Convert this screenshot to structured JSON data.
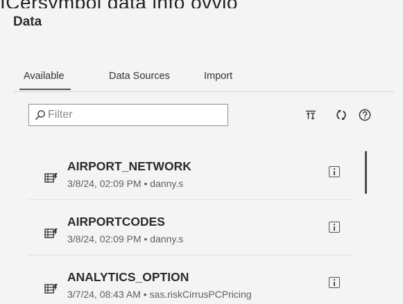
{
  "top_clipped_text": "ICersymbol data info ovvio",
  "panel": {
    "title": "Data"
  },
  "tabs": [
    {
      "label": "Available",
      "active": true
    },
    {
      "label": "Data Sources",
      "active": false
    },
    {
      "label": "Import",
      "active": false
    }
  ],
  "filter": {
    "placeholder": "Filter",
    "value": ""
  },
  "toolbar": {
    "sort_icon": "sort-icon",
    "refresh_icon": "refresh-icon",
    "help_icon": "help-icon"
  },
  "tables": [
    {
      "name": "AIRPORT_NETWORK",
      "meta": "3/8/24, 02:09 PM • danny.s"
    },
    {
      "name": "AIRPORTCODES",
      "meta": "3/8/24, 02:09 PM • danny.s"
    },
    {
      "name": "ANALYTICS_OPTION",
      "meta": "3/7/24, 08:43 AM • sas.riskCirrusPCPricing"
    }
  ],
  "colors": {
    "background": "#f4f4f4",
    "text": "#333333",
    "divider": "#d6d6d6",
    "accent": "#4f4f4f"
  }
}
